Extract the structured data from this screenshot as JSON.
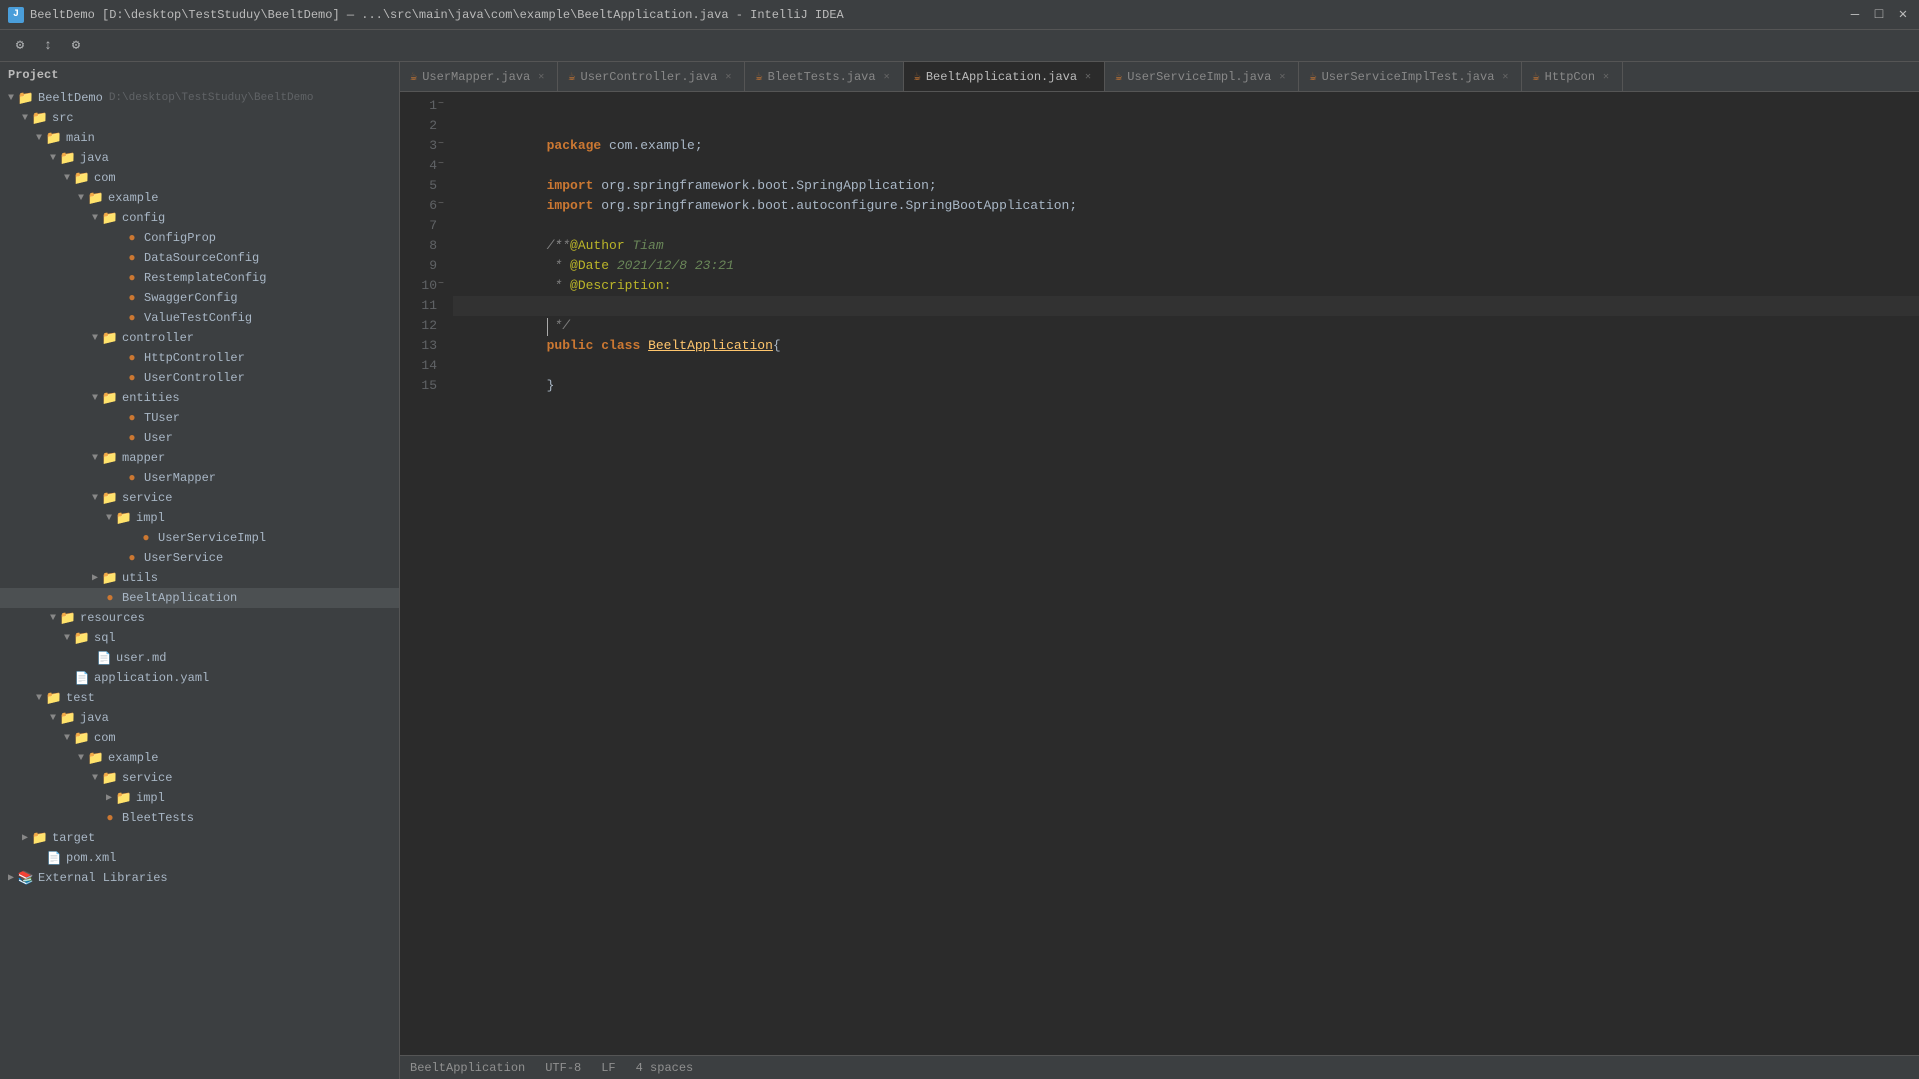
{
  "titleBar": {
    "icon": "B",
    "text": "BeeltDemo [D:\\desktop\\TestStuduy\\BeeltDemo] — ...\\src\\main\\java\\com\\example\\BeeltApplication.java - IntelliJ IDEA",
    "minimize": "—",
    "maximize": "□",
    "close": "✕"
  },
  "tabs": [
    {
      "id": "UserMapper",
      "label": "UserMapper.java",
      "color": "#cc7832",
      "active": false,
      "modified": false
    },
    {
      "id": "UserController",
      "label": "UserController.java",
      "color": "#cc7832",
      "active": false,
      "modified": false
    },
    {
      "id": "BleetTests",
      "label": "BleetTests.java",
      "color": "#cc7832",
      "active": false,
      "modified": false
    },
    {
      "id": "BeeltApplication",
      "label": "BeeltApplication.java",
      "color": "#cc7832",
      "active": true,
      "modified": false
    },
    {
      "id": "UserServiceImpl",
      "label": "UserServiceImpl.java",
      "color": "#cc7832",
      "active": false,
      "modified": false
    },
    {
      "id": "UserServiceImplTest",
      "label": "UserServiceImplTest.java",
      "color": "#cc7832",
      "active": false,
      "modified": false
    },
    {
      "id": "HttpCon",
      "label": "HttpCon",
      "color": "#cc7832",
      "active": false,
      "modified": false
    }
  ],
  "sidebar": {
    "header": "Project",
    "tree": [
      {
        "id": "BeeltDemo",
        "label": "BeeltDemo",
        "type": "project",
        "level": 0,
        "expanded": true,
        "suffix": "D:\\desktop\\TestStuduy\\BeeltDemo"
      },
      {
        "id": "src",
        "label": "src",
        "type": "folder",
        "level": 1,
        "expanded": true
      },
      {
        "id": "main",
        "label": "main",
        "type": "folder",
        "level": 2,
        "expanded": true
      },
      {
        "id": "java",
        "label": "java",
        "type": "src-folder",
        "level": 3,
        "expanded": true
      },
      {
        "id": "com",
        "label": "com",
        "type": "folder",
        "level": 4,
        "expanded": true
      },
      {
        "id": "example",
        "label": "example",
        "type": "folder",
        "level": 5,
        "expanded": true
      },
      {
        "id": "config",
        "label": "config",
        "type": "folder",
        "level": 6,
        "expanded": true
      },
      {
        "id": "ConfigProp",
        "label": "ConfigProp",
        "type": "java",
        "level": 7
      },
      {
        "id": "DataSourceConfig",
        "label": "DataSourceConfig",
        "type": "java",
        "level": 7
      },
      {
        "id": "RestemplateConfig",
        "label": "RestemplateConfig",
        "type": "java",
        "level": 7
      },
      {
        "id": "SwaggerConfig",
        "label": "SwaggerConfig",
        "type": "java",
        "level": 7
      },
      {
        "id": "ValueTestConfig",
        "label": "ValueTestConfig",
        "type": "java",
        "level": 7
      },
      {
        "id": "controller",
        "label": "controller",
        "type": "folder",
        "level": 6,
        "expanded": true
      },
      {
        "id": "HttpController",
        "label": "HttpController",
        "type": "java",
        "level": 7
      },
      {
        "id": "UserController2",
        "label": "UserController",
        "type": "java",
        "level": 7
      },
      {
        "id": "entities",
        "label": "entities",
        "type": "folder",
        "level": 6,
        "expanded": true
      },
      {
        "id": "TUser",
        "label": "TUser",
        "type": "java",
        "level": 7
      },
      {
        "id": "User",
        "label": "User",
        "type": "java",
        "level": 7
      },
      {
        "id": "mapper",
        "label": "mapper",
        "type": "folder",
        "level": 6,
        "expanded": true
      },
      {
        "id": "UserMapper2",
        "label": "UserMapper",
        "type": "java",
        "level": 7
      },
      {
        "id": "service",
        "label": "service",
        "type": "folder",
        "level": 6,
        "expanded": true
      },
      {
        "id": "impl",
        "label": "impl",
        "type": "folder",
        "level": 7,
        "expanded": true
      },
      {
        "id": "UserServiceImpl2",
        "label": "UserServiceImpl",
        "type": "java",
        "level": 8
      },
      {
        "id": "UserService",
        "label": "UserService",
        "type": "java",
        "level": 7
      },
      {
        "id": "utils",
        "label": "utils",
        "type": "folder",
        "level": 6,
        "expanded": false
      },
      {
        "id": "BeeltApplication2",
        "label": "BeeltApplication",
        "type": "java",
        "level": 6
      },
      {
        "id": "resources",
        "label": "resources",
        "type": "res-folder",
        "level": 3,
        "expanded": true
      },
      {
        "id": "sql",
        "label": "sql",
        "type": "folder",
        "level": 4,
        "expanded": true
      },
      {
        "id": "user.md",
        "label": "user.md",
        "type": "md",
        "level": 5
      },
      {
        "id": "application.yaml",
        "label": "application.yaml",
        "type": "yaml",
        "level": 4
      },
      {
        "id": "test",
        "label": "test",
        "type": "folder",
        "level": 2,
        "expanded": true
      },
      {
        "id": "java2",
        "label": "java",
        "type": "src-folder",
        "level": 3,
        "expanded": true
      },
      {
        "id": "com2",
        "label": "com",
        "type": "folder",
        "level": 4,
        "expanded": true
      },
      {
        "id": "example2",
        "label": "example",
        "type": "folder",
        "level": 5,
        "expanded": true
      },
      {
        "id": "service2",
        "label": "service",
        "type": "folder",
        "level": 6,
        "expanded": true
      },
      {
        "id": "impl2",
        "label": "impl",
        "type": "folder",
        "level": 7,
        "expanded": false
      },
      {
        "id": "BleetTests2",
        "label": "BleetTests",
        "type": "java",
        "level": 6
      },
      {
        "id": "target",
        "label": "target",
        "type": "folder",
        "level": 1,
        "expanded": false
      },
      {
        "id": "pom.xml",
        "label": "pom.xml",
        "type": "xml",
        "level": 1
      },
      {
        "id": "External Libraries",
        "label": "External Libraries",
        "type": "ext-lib",
        "level": 0,
        "expanded": false
      }
    ]
  },
  "editor": {
    "filename": "BeeltApplication.java",
    "lines": [
      {
        "num": 1,
        "content": "package_com_example_semicolon"
      },
      {
        "num": 2,
        "content": ""
      },
      {
        "num": 3,
        "content": "import_spring_boot"
      },
      {
        "num": 4,
        "content": "import_autoconfigure"
      },
      {
        "num": 5,
        "content": ""
      },
      {
        "num": 6,
        "content": "comment_start"
      },
      {
        "num": 7,
        "content": "author_tiam"
      },
      {
        "num": 8,
        "content": "date_value"
      },
      {
        "num": 9,
        "content": "description"
      },
      {
        "num": 10,
        "content": "comment_end"
      },
      {
        "num": 11,
        "content": ""
      },
      {
        "num": 12,
        "content": "class_decl"
      },
      {
        "num": 13,
        "content": ""
      },
      {
        "num": 14,
        "content": "closing_brace"
      },
      {
        "num": 15,
        "content": ""
      }
    ]
  },
  "statusBar": {
    "filename": "BeeltApplication",
    "encoding": "UTF-8",
    "lineEnding": "LF",
    "indent": "4 spaces"
  }
}
